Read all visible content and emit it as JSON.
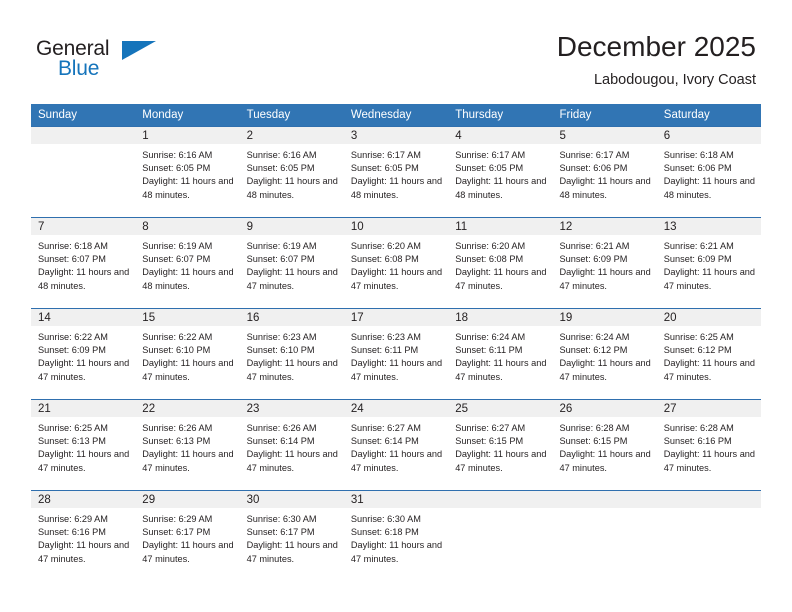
{
  "brand": {
    "name_part1": "General",
    "name_part2": "Blue",
    "color_primary": "#1574bb",
    "color_text": "#231f20"
  },
  "header": {
    "title": "December 2025",
    "subtitle": "Labodougou, Ivory Coast"
  },
  "calendar": {
    "header_bg": "#3175b4",
    "date_band_bg": "#f0f0f0",
    "row_border": "#2f6fae",
    "weekday_headers": [
      "Sunday",
      "Monday",
      "Tuesday",
      "Wednesday",
      "Thursday",
      "Friday",
      "Saturday"
    ],
    "weeks": [
      [
        {
          "day": "",
          "empty": true,
          "sunrise": "",
          "sunset": "",
          "daylight": ""
        },
        {
          "day": "1",
          "empty": false,
          "sunrise": "Sunrise: 6:16 AM",
          "sunset": "Sunset: 6:05 PM",
          "daylight": "Daylight: 11 hours and 48 minutes."
        },
        {
          "day": "2",
          "empty": false,
          "sunrise": "Sunrise: 6:16 AM",
          "sunset": "Sunset: 6:05 PM",
          "daylight": "Daylight: 11 hours and 48 minutes."
        },
        {
          "day": "3",
          "empty": false,
          "sunrise": "Sunrise: 6:17 AM",
          "sunset": "Sunset: 6:05 PM",
          "daylight": "Daylight: 11 hours and 48 minutes."
        },
        {
          "day": "4",
          "empty": false,
          "sunrise": "Sunrise: 6:17 AM",
          "sunset": "Sunset: 6:05 PM",
          "daylight": "Daylight: 11 hours and 48 minutes."
        },
        {
          "day": "5",
          "empty": false,
          "sunrise": "Sunrise: 6:17 AM",
          "sunset": "Sunset: 6:06 PM",
          "daylight": "Daylight: 11 hours and 48 minutes."
        },
        {
          "day": "6",
          "empty": false,
          "sunrise": "Sunrise: 6:18 AM",
          "sunset": "Sunset: 6:06 PM",
          "daylight": "Daylight: 11 hours and 48 minutes."
        }
      ],
      [
        {
          "day": "7",
          "empty": false,
          "sunrise": "Sunrise: 6:18 AM",
          "sunset": "Sunset: 6:07 PM",
          "daylight": "Daylight: 11 hours and 48 minutes."
        },
        {
          "day": "8",
          "empty": false,
          "sunrise": "Sunrise: 6:19 AM",
          "sunset": "Sunset: 6:07 PM",
          "daylight": "Daylight: 11 hours and 48 minutes."
        },
        {
          "day": "9",
          "empty": false,
          "sunrise": "Sunrise: 6:19 AM",
          "sunset": "Sunset: 6:07 PM",
          "daylight": "Daylight: 11 hours and 47 minutes."
        },
        {
          "day": "10",
          "empty": false,
          "sunrise": "Sunrise: 6:20 AM",
          "sunset": "Sunset: 6:08 PM",
          "daylight": "Daylight: 11 hours and 47 minutes."
        },
        {
          "day": "11",
          "empty": false,
          "sunrise": "Sunrise: 6:20 AM",
          "sunset": "Sunset: 6:08 PM",
          "daylight": "Daylight: 11 hours and 47 minutes."
        },
        {
          "day": "12",
          "empty": false,
          "sunrise": "Sunrise: 6:21 AM",
          "sunset": "Sunset: 6:09 PM",
          "daylight": "Daylight: 11 hours and 47 minutes."
        },
        {
          "day": "13",
          "empty": false,
          "sunrise": "Sunrise: 6:21 AM",
          "sunset": "Sunset: 6:09 PM",
          "daylight": "Daylight: 11 hours and 47 minutes."
        }
      ],
      [
        {
          "day": "14",
          "empty": false,
          "sunrise": "Sunrise: 6:22 AM",
          "sunset": "Sunset: 6:09 PM",
          "daylight": "Daylight: 11 hours and 47 minutes."
        },
        {
          "day": "15",
          "empty": false,
          "sunrise": "Sunrise: 6:22 AM",
          "sunset": "Sunset: 6:10 PM",
          "daylight": "Daylight: 11 hours and 47 minutes."
        },
        {
          "day": "16",
          "empty": false,
          "sunrise": "Sunrise: 6:23 AM",
          "sunset": "Sunset: 6:10 PM",
          "daylight": "Daylight: 11 hours and 47 minutes."
        },
        {
          "day": "17",
          "empty": false,
          "sunrise": "Sunrise: 6:23 AM",
          "sunset": "Sunset: 6:11 PM",
          "daylight": "Daylight: 11 hours and 47 minutes."
        },
        {
          "day": "18",
          "empty": false,
          "sunrise": "Sunrise: 6:24 AM",
          "sunset": "Sunset: 6:11 PM",
          "daylight": "Daylight: 11 hours and 47 minutes."
        },
        {
          "day": "19",
          "empty": false,
          "sunrise": "Sunrise: 6:24 AM",
          "sunset": "Sunset: 6:12 PM",
          "daylight": "Daylight: 11 hours and 47 minutes."
        },
        {
          "day": "20",
          "empty": false,
          "sunrise": "Sunrise: 6:25 AM",
          "sunset": "Sunset: 6:12 PM",
          "daylight": "Daylight: 11 hours and 47 minutes."
        }
      ],
      [
        {
          "day": "21",
          "empty": false,
          "sunrise": "Sunrise: 6:25 AM",
          "sunset": "Sunset: 6:13 PM",
          "daylight": "Daylight: 11 hours and 47 minutes."
        },
        {
          "day": "22",
          "empty": false,
          "sunrise": "Sunrise: 6:26 AM",
          "sunset": "Sunset: 6:13 PM",
          "daylight": "Daylight: 11 hours and 47 minutes."
        },
        {
          "day": "23",
          "empty": false,
          "sunrise": "Sunrise: 6:26 AM",
          "sunset": "Sunset: 6:14 PM",
          "daylight": "Daylight: 11 hours and 47 minutes."
        },
        {
          "day": "24",
          "empty": false,
          "sunrise": "Sunrise: 6:27 AM",
          "sunset": "Sunset: 6:14 PM",
          "daylight": "Daylight: 11 hours and 47 minutes."
        },
        {
          "day": "25",
          "empty": false,
          "sunrise": "Sunrise: 6:27 AM",
          "sunset": "Sunset: 6:15 PM",
          "daylight": "Daylight: 11 hours and 47 minutes."
        },
        {
          "day": "26",
          "empty": false,
          "sunrise": "Sunrise: 6:28 AM",
          "sunset": "Sunset: 6:15 PM",
          "daylight": "Daylight: 11 hours and 47 minutes."
        },
        {
          "day": "27",
          "empty": false,
          "sunrise": "Sunrise: 6:28 AM",
          "sunset": "Sunset: 6:16 PM",
          "daylight": "Daylight: 11 hours and 47 minutes."
        }
      ],
      [
        {
          "day": "28",
          "empty": false,
          "sunrise": "Sunrise: 6:29 AM",
          "sunset": "Sunset: 6:16 PM",
          "daylight": "Daylight: 11 hours and 47 minutes."
        },
        {
          "day": "29",
          "empty": false,
          "sunrise": "Sunrise: 6:29 AM",
          "sunset": "Sunset: 6:17 PM",
          "daylight": "Daylight: 11 hours and 47 minutes."
        },
        {
          "day": "30",
          "empty": false,
          "sunrise": "Sunrise: 6:30 AM",
          "sunset": "Sunset: 6:17 PM",
          "daylight": "Daylight: 11 hours and 47 minutes."
        },
        {
          "day": "31",
          "empty": false,
          "sunrise": "Sunrise: 6:30 AM",
          "sunset": "Sunset: 6:18 PM",
          "daylight": "Daylight: 11 hours and 47 minutes."
        },
        {
          "day": "",
          "empty": true,
          "sunrise": "",
          "sunset": "",
          "daylight": ""
        },
        {
          "day": "",
          "empty": true,
          "sunrise": "",
          "sunset": "",
          "daylight": ""
        },
        {
          "day": "",
          "empty": true,
          "sunrise": "",
          "sunset": "",
          "daylight": ""
        }
      ]
    ]
  }
}
